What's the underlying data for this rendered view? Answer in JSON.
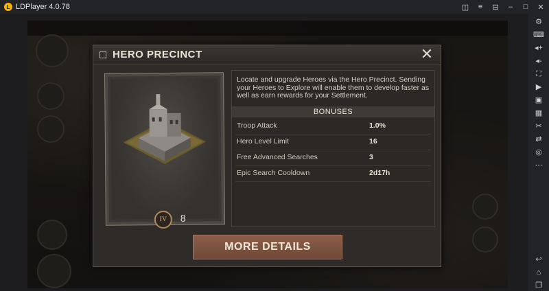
{
  "window": {
    "title": "LDPlayer 4.0.78"
  },
  "titlebar": {
    "controls": [
      "gamepad-icon",
      "menu-icon",
      "minimize-icon",
      "restore-icon",
      "maximize-icon",
      "close-icon"
    ]
  },
  "sidebar": {
    "tools": [
      "settings-icon",
      "keyboard-icon",
      "volume-up-icon",
      "volume-down-icon",
      "screen-rotate-icon",
      "record-icon",
      "screenshot-icon",
      "apk-icon",
      "scissors-icon",
      "shake-icon",
      "more-icon",
      "back-icon",
      "home-icon",
      "recent-apps-icon"
    ]
  },
  "modal": {
    "title": "HERO PRECINCT",
    "close_label": "✕",
    "level_roman": "IV",
    "level_number": "8",
    "description": "Locate and upgrade Heroes via the Hero Precinct. Sending your Heroes to Explore will enable them to develop faster as well as earn rewards for your Settlement.",
    "bonuses_heading": "BONUSES",
    "bonuses": [
      {
        "label": "Troop Attack",
        "value": "1.0%"
      },
      {
        "label": "Hero Level Limit",
        "value": "16"
      },
      {
        "label": "Free Advanced Searches",
        "value": "3"
      },
      {
        "label": "Epic Search Cooldown",
        "value": "2d17h"
      }
    ],
    "more_details_label": "MORE DETAILS"
  }
}
